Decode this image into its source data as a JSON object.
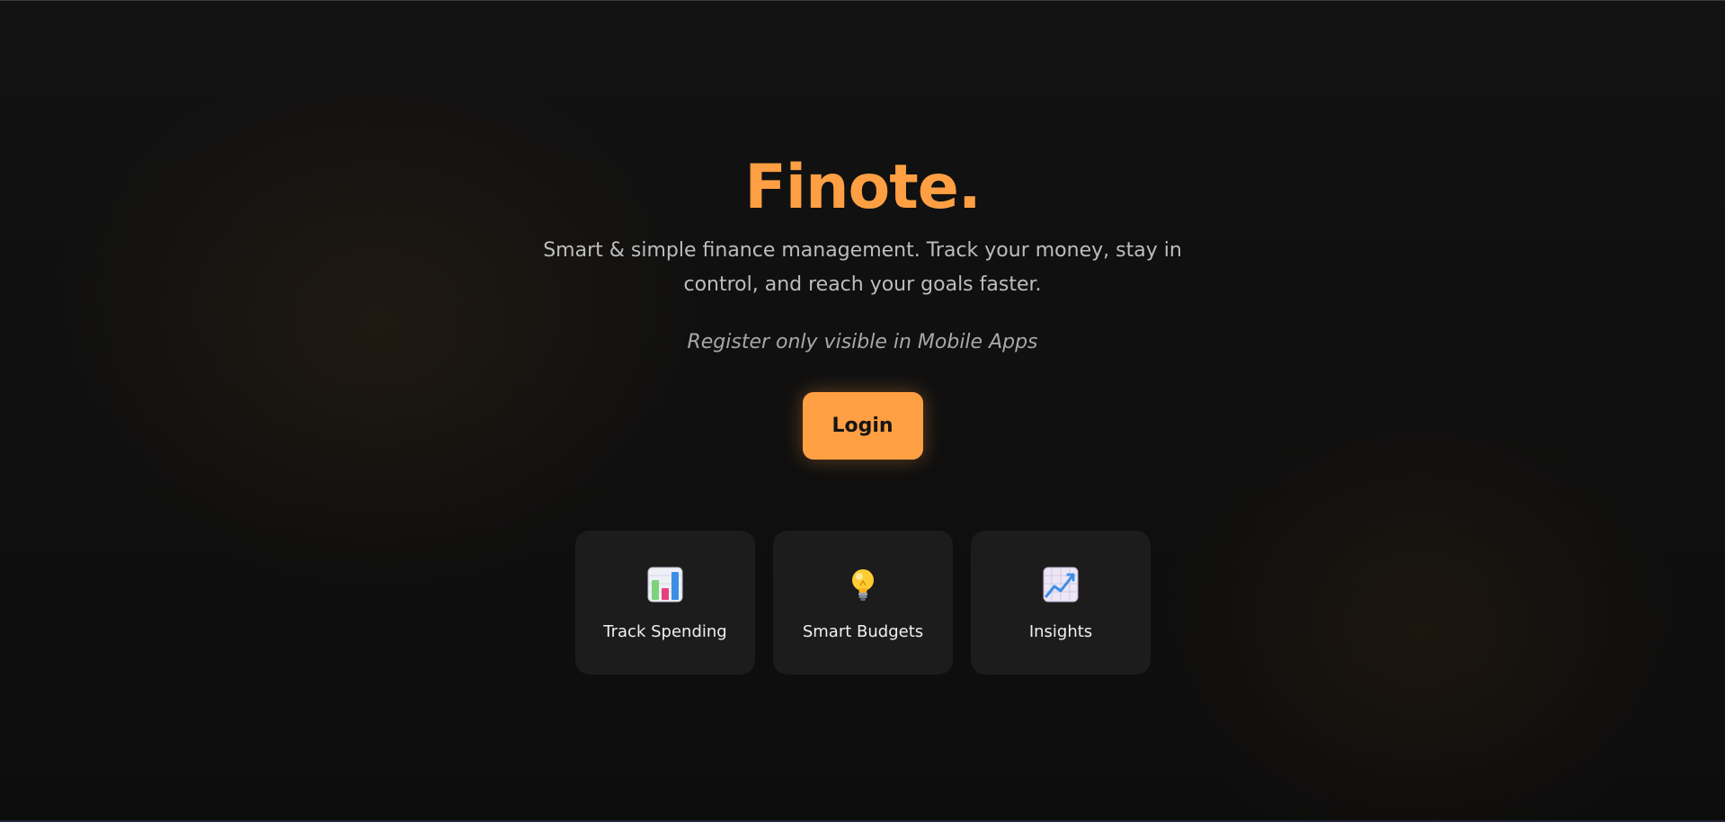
{
  "hero": {
    "brand": "Finote.",
    "tagline": "Smart & simple finance management. Track your money, stay in control, and reach your goals faster.",
    "register_note": "Register only visible in Mobile Apps",
    "login_label": "Login"
  },
  "features": [
    {
      "label": "Track Spending",
      "icon": "bar-chart-icon"
    },
    {
      "label": "Smart Budgets",
      "icon": "light-bulb-icon"
    },
    {
      "label": "Insights",
      "icon": "chart-increasing-icon"
    }
  ],
  "colors": {
    "accent": "#ff9f43",
    "background": "#0e0e0e",
    "card": "#1c1c1c",
    "tagline": "#bdbdbd",
    "note": "#a8a8a8"
  }
}
